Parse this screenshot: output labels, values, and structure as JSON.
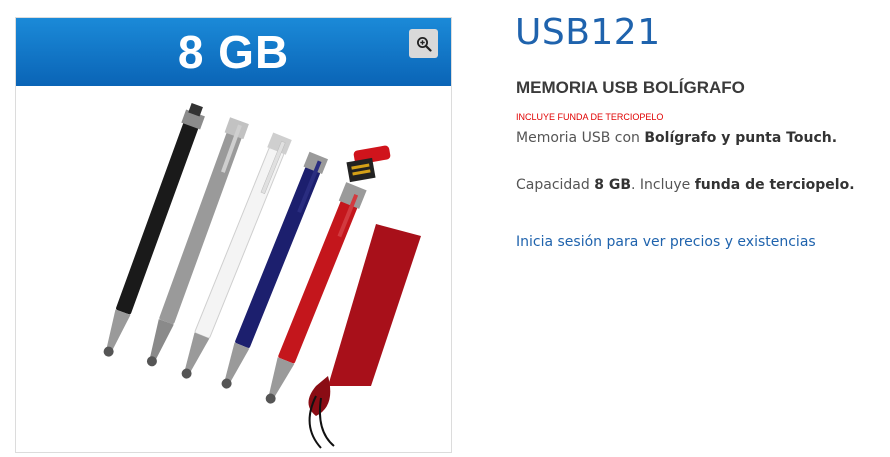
{
  "image": {
    "banner_text": "8 GB",
    "zoom_icon": "zoom-in-icon",
    "colors": {
      "banner": "#0a64b6",
      "pen_black": "#1a1a1a",
      "pen_silver": "#9a9a9a",
      "pen_white": "#f4f4f4",
      "pen_navy": "#1c1f6e",
      "pen_red": "#c4161c",
      "pouch": "#a8101a"
    }
  },
  "product": {
    "sku": "USB121",
    "name": "MEMORIA USB BOLÍGRAFO",
    "promo": "INCLUYE FUNDA DE TERCIOPELO",
    "desc1": {
      "prefix": "Memoria USB con ",
      "bold": "Bolígrafo y punta Touch."
    },
    "desc2": {
      "prefix": "Capacidad ",
      "bold1": "8 GB",
      "mid": ". Incluye ",
      "bold2": "funda de terciopelo."
    },
    "login_link": "Inicia sesión para ver precios y existencias"
  }
}
